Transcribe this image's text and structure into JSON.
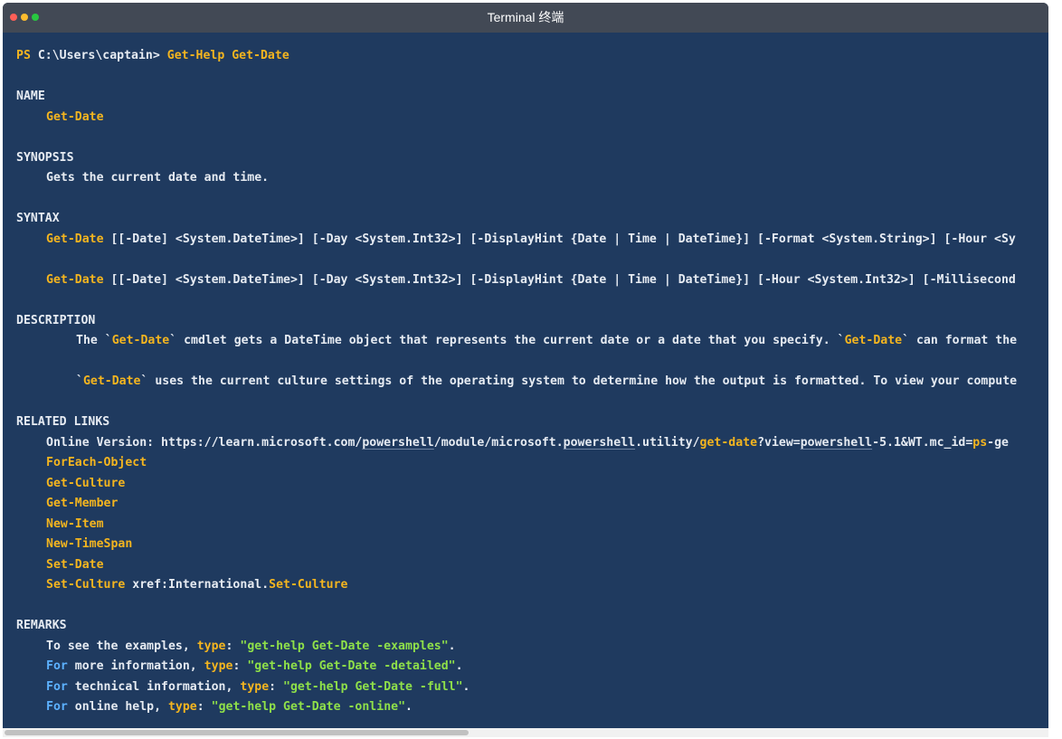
{
  "window": {
    "title": "Terminal  终端",
    "traffic_lights": {
      "close": "#ff5f57",
      "minimize": "#febc2e",
      "zoom": "#28c840"
    }
  },
  "colors": {
    "background": "#1f3a5f",
    "text": "#e6ebf2",
    "keyword": "#f4b51f",
    "string": "#8fe049",
    "builtin": "#5cb1ff"
  },
  "prompt": {
    "ps": "PS",
    "path": "C:\\Users\\captain>",
    "command": "Get-Help Get-Date"
  },
  "help": {
    "name": {
      "heading": "NAME",
      "value": "Get-Date"
    },
    "synopsis": {
      "heading": "SYNOPSIS",
      "text": "Gets the current date and time."
    },
    "syntax": {
      "heading": "SYNTAX",
      "lines": [
        {
          "cmd": "Get-Date",
          "rest": " [[-Date] <System.DateTime>] [-Day <System.Int32>] [-DisplayHint {Date | Time | DateTime}] [-Format <System.String>] [-Hour <Sy"
        },
        {
          "cmd": "Get-Date",
          "rest": " [[-Date] <System.DateTime>] [-Day <System.Int32>] [-DisplayHint {Date | Time | DateTime}] [-Hour <System.Int32>] [-Millisecond"
        }
      ]
    },
    "description": {
      "heading": "DESCRIPTION",
      "p1": {
        "pre": "The `",
        "cmd1": "Get-Date",
        "mid": "` cmdlet gets a DateTime object that represents the current date or a date that you specify. `",
        "cmd2": "Get-Date",
        "post": "` can format the"
      },
      "p2": {
        "pre": "`",
        "cmd": "Get-Date",
        "post": "` uses the current culture settings of the operating system to determine how the output is formatted. To view your compute"
      }
    },
    "related_links": {
      "heading": "RELATED LINKS",
      "online": {
        "label": "Online Version: https://learn.microsoft.com/",
        "u1": "powershell",
        "s2": "/module/microsoft.",
        "u2": "powershell",
        "s3": ".utility/",
        "hl": "get-date",
        "s4": "?view=",
        "u3": "powershell",
        "s5": "-5.1&WT.mc_id=",
        "hl2": "ps",
        "s6": "-ge"
      },
      "items": [
        "ForEach-Object",
        "Get-Culture",
        "Get-Member",
        "New-Item",
        "New-TimeSpan",
        "Set-Date"
      ],
      "last": {
        "cmd": "Set-Culture",
        "mid": " xref:International.",
        "cmd2": "Set-Culture"
      }
    },
    "remarks": {
      "heading": "REMARKS",
      "lines": [
        {
          "pre": "To see the examples, ",
          "kw": "type",
          "colon": ": ",
          "str": "\"get-help Get-Date -examples\"",
          "end": "."
        },
        {
          "pre": "For",
          "mid": " more information, ",
          "kw": "type",
          "colon": ": ",
          "str": "\"get-help Get-Date -detailed\"",
          "end": "."
        },
        {
          "pre": "For",
          "mid": " technical information, ",
          "kw": "type",
          "colon": ": ",
          "str": "\"get-help Get-Date -full\"",
          "end": "."
        },
        {
          "pre": "For",
          "mid": " online help, ",
          "kw": "type",
          "colon": ": ",
          "str": "\"get-help Get-Date -online\"",
          "end": "."
        }
      ]
    }
  }
}
